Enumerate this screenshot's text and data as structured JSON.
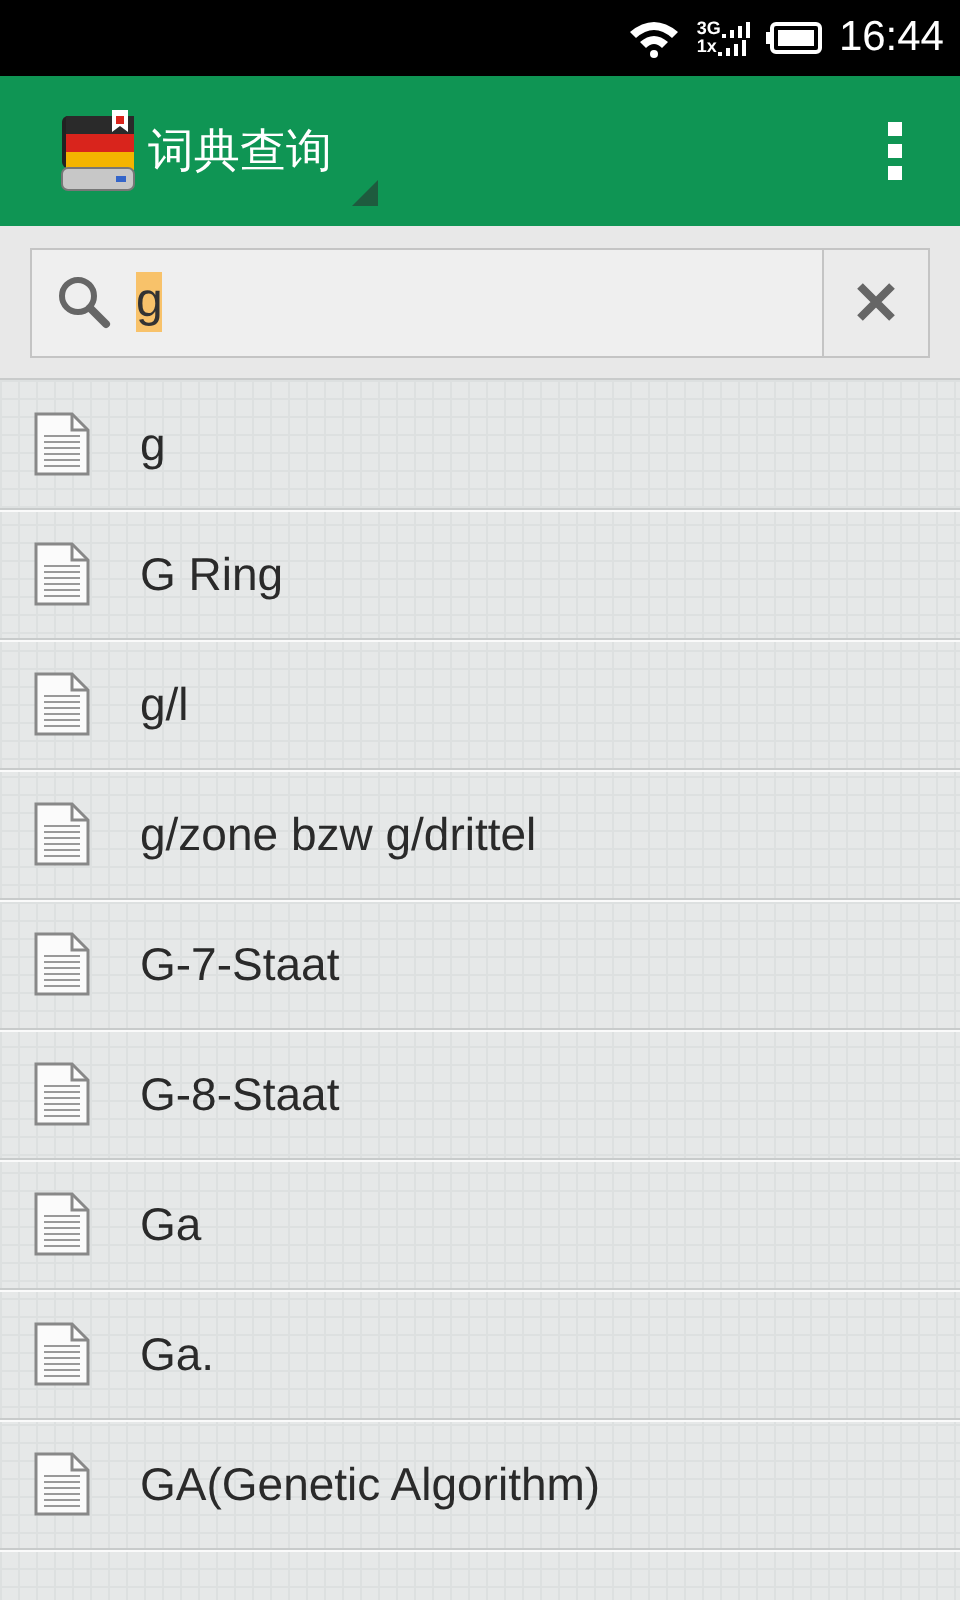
{
  "status_bar": {
    "network_top": "3G",
    "network_bottom": "1x",
    "time": "16:44"
  },
  "app_bar": {
    "title": "词典查询"
  },
  "search": {
    "value": "g",
    "value_selected": true
  },
  "results": [
    {
      "label": "g"
    },
    {
      "label": "G Ring"
    },
    {
      "label": "g/l"
    },
    {
      "label": "g/zone bzw g/drittel"
    },
    {
      "label": "G-7-Staat"
    },
    {
      "label": "G-8-Staat"
    },
    {
      "label": "Ga"
    },
    {
      "label": "Ga."
    },
    {
      "label": "GA(Genetic Algorithm)"
    }
  ]
}
